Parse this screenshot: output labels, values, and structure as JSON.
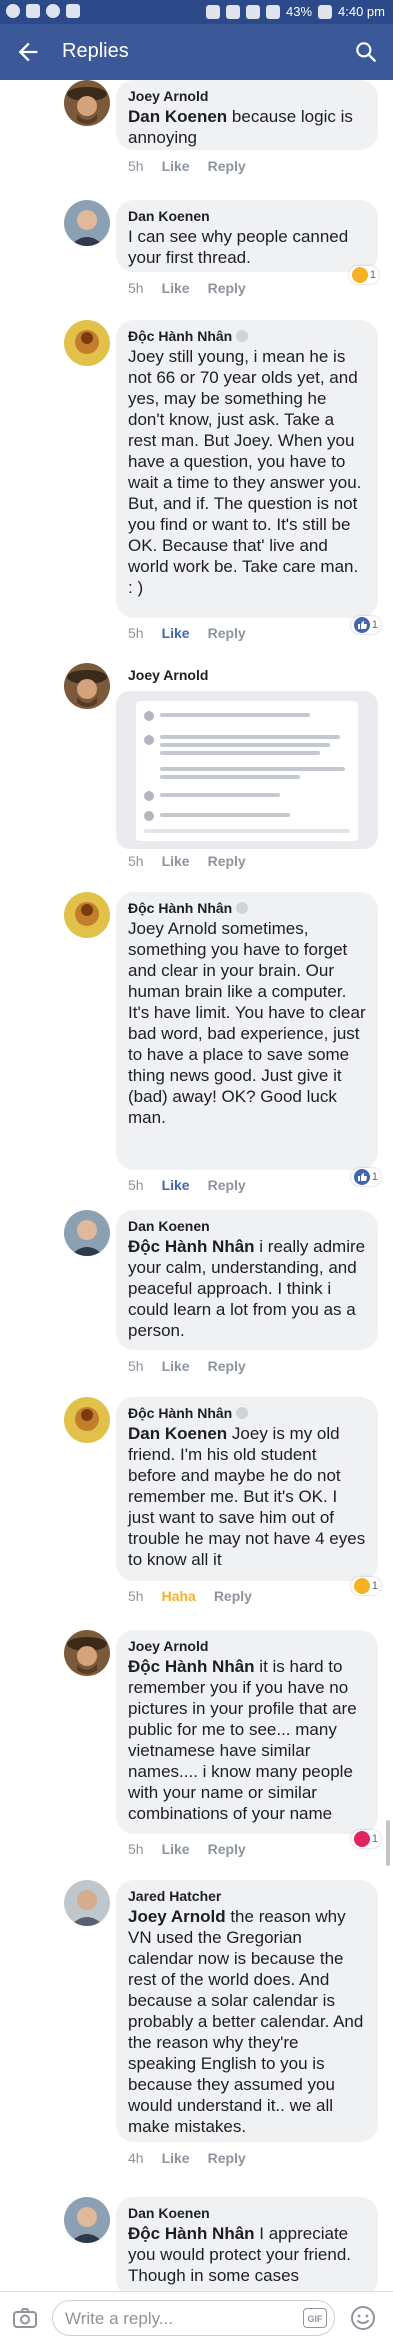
{
  "status_bar": {
    "battery": "43%",
    "time": "4:40 pm"
  },
  "app_bar": {
    "title": "Replies",
    "back_icon": "arrow-left-icon",
    "search_icon": "search-icon"
  },
  "actions": {
    "like": "Like",
    "reply": "Reply",
    "haha": "Haha"
  },
  "comments": [
    {
      "author": "Joey Arnold",
      "mention": "Dan Koenen",
      "text": " because logic is annoying",
      "time": "5h",
      "reaction_count": ""
    },
    {
      "author": "Dan Koenen",
      "mention": "",
      "text": "I can see why people canned your first thread.",
      "time": "5h",
      "reaction_count": "1"
    },
    {
      "author": "Độc Hành Nhân",
      "mention": "",
      "text": "Joey still young, i mean he is not 66 or 70 year olds yet, and yes, may be something he don't know, just ask. Take a rest man. But Joey. When you have a question, you have to wait a time to they answer you. But, and if. The question is not you find or want to. It's still be OK. Because that' live and world work be. Take care man. : )",
      "time": "5h",
      "reaction_count": "1"
    },
    {
      "author": "Joey Arnold",
      "mention": "",
      "text": "",
      "time": "5h",
      "reaction_count": ""
    },
    {
      "author": "Độc Hành Nhân",
      "mention": "",
      "text": "Joey Arnold sometimes, something you have to forget and clear in your brain. Our human brain like a computer. It's have limit. You have to clear bad word, bad experience, just to have a place to save some thing news good. Just give it (bad) away!  OK? Good luck man.",
      "time": "5h",
      "reaction_count": "1"
    },
    {
      "author": "Dan Koenen",
      "mention": "Độc Hành Nhân",
      "text": " i really admire your calm, understanding, and peaceful approach. I think i could learn a lot from you as a person.",
      "time": "5h",
      "reaction_count": ""
    },
    {
      "author": "Độc Hành Nhân",
      "mention": "Dan Koenen",
      "text": " Joey is my old friend. I'm his old student before and maybe he do not remember me. But it's OK. I just want to save him out of trouble he may not have 4 eyes to know all it",
      "time": "5h",
      "reaction_count": "1"
    },
    {
      "author": "Joey Arnold",
      "mention": "Độc Hành Nhân",
      "text": " it is hard to remember you if you have no pictures in your profile that are public for me to see... many vietnamese have similar names.... i know many people with your name or similar combinations of your name",
      "time": "5h",
      "reaction_count": "1"
    },
    {
      "author": "Jared Hatcher",
      "mention": "Joey Arnold",
      "text": " the reason why VN used the Gregorian calendar now is because the rest of the world does. And because a solar calendar is probably a better calendar. And the reason why they're speaking English to you is because they assumed you would understand it.. we all make mistakes.",
      "time": "4h",
      "reaction_count": ""
    },
    {
      "author": "Dan Koenen",
      "mention": "Độc Hành Nhân",
      "text": " I appreciate you would protect your friend. Though in some cases",
      "time": "",
      "reaction_count": ""
    }
  ],
  "composer": {
    "placeholder": "Write a reply...",
    "gif_label": "GIF"
  },
  "colors": {
    "brand_blue": "#3b5998",
    "like_blue": "#4267b2",
    "haha_yellow": "#f7b125",
    "bubble_gray": "#f0f1f3"
  }
}
